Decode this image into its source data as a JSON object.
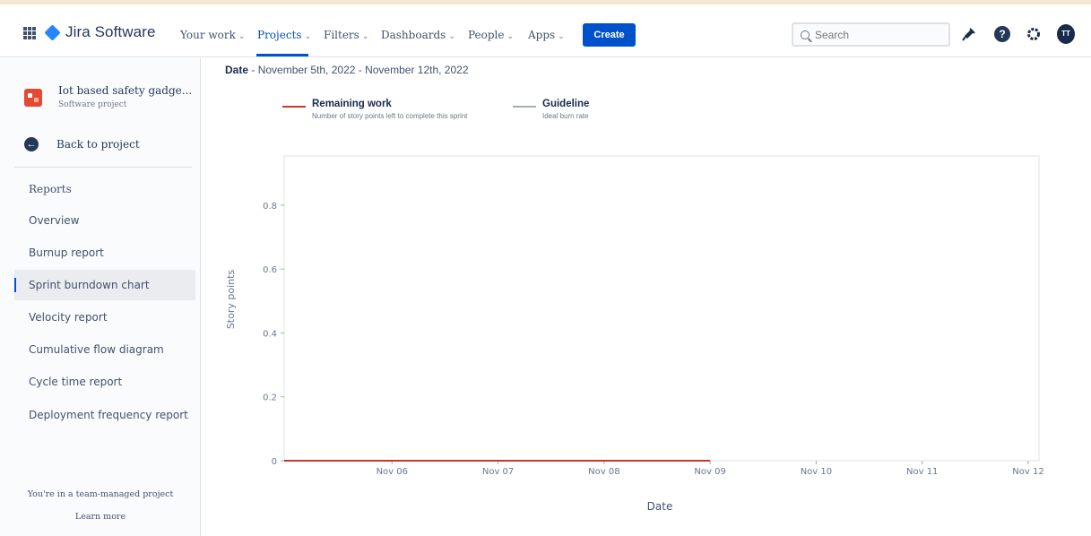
{
  "app": {
    "name": "Jira Software",
    "accent": "#0052cc"
  },
  "nav": {
    "items": [
      {
        "label": "Your work"
      },
      {
        "label": "Projects",
        "active": true
      },
      {
        "label": "Filters"
      },
      {
        "label": "Dashboards"
      },
      {
        "label": "People"
      },
      {
        "label": "Apps"
      }
    ],
    "create_label": "Create",
    "search_placeholder": "Search",
    "avatar_initials": "TT",
    "help_glyph": "?",
    "icons": [
      "app-switcher-icon",
      "jira-logo-icon",
      "notifications-icon",
      "help-icon",
      "settings-icon",
      "avatar"
    ]
  },
  "sidebar": {
    "project_name": "Iot based safety gadge...",
    "project_type": "Software project",
    "back_label": "Back to project",
    "heading": "Reports",
    "items": [
      {
        "label": "Overview"
      },
      {
        "label": "Burnup report"
      },
      {
        "label": "Sprint burndown chart",
        "active": true
      },
      {
        "label": "Velocity report"
      },
      {
        "label": "Cumulative flow diagram"
      },
      {
        "label": "Cycle time report"
      },
      {
        "label": "Deployment frequency report"
      }
    ],
    "footer_text": "You're in a team-managed project",
    "footer_link": "Learn more"
  },
  "report": {
    "date_label": "Date",
    "date_range": "November 5th, 2022 - November 12th, 2022",
    "legend": [
      {
        "title": "Remaining work",
        "desc": "Number of story points left to complete this sprint",
        "color": "#c9372c"
      },
      {
        "title": "Guideline",
        "desc": "Ideal burn rate",
        "color": "#a5adba"
      }
    ]
  },
  "chart_data": {
    "type": "line",
    "title": "",
    "xlabel": "Date",
    "ylabel": "Story points",
    "x_ticks": [
      "Nov 06",
      "Nov 07",
      "Nov 08",
      "Nov 09",
      "Nov 10",
      "Nov 11",
      "Nov 12"
    ],
    "y_ticks": [
      0,
      0.2,
      0.4,
      0.6,
      0.8
    ],
    "ylim": [
      0,
      1
    ],
    "xlim": [
      "Nov 05",
      "Nov 12"
    ],
    "grid": false,
    "series": [
      {
        "name": "Remaining work",
        "color": "#c9372c",
        "points": [
          {
            "x": "Nov 05",
            "y": 0
          },
          {
            "x": "Nov 09",
            "y": 0
          }
        ]
      }
    ]
  }
}
